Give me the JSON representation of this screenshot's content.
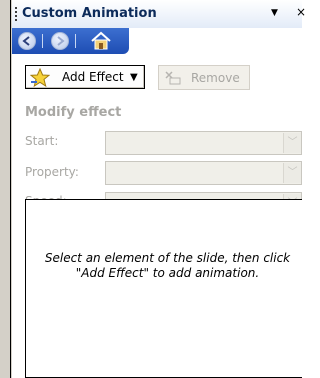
{
  "title_bar": {
    "title": "Custom Animation",
    "menu_glyph": "▼",
    "close_glyph": "×"
  },
  "nav": {
    "back_icon": "back-arrow-icon",
    "forward_icon": "forward-arrow-icon",
    "home_icon": "home-icon"
  },
  "toolbar": {
    "add_effect_label": "Add Effect",
    "add_effect_icon": "star-icon",
    "remove_label": "Remove",
    "remove_icon": "remove-effect-icon"
  },
  "modify": {
    "heading": "Modify effect",
    "start_label": "Start:",
    "property_label": "Property:",
    "speed_label": "Speed:",
    "start_value": "",
    "property_value": "",
    "speed_value": ""
  },
  "effects_list": {
    "empty_message": "Select an element of the slide, then click \"Add Effect\" to add animation."
  },
  "colors": {
    "nav_bar": "#2a58c0",
    "title_text": "#0b2a5a",
    "disabled_text": "#a8a7a3"
  }
}
